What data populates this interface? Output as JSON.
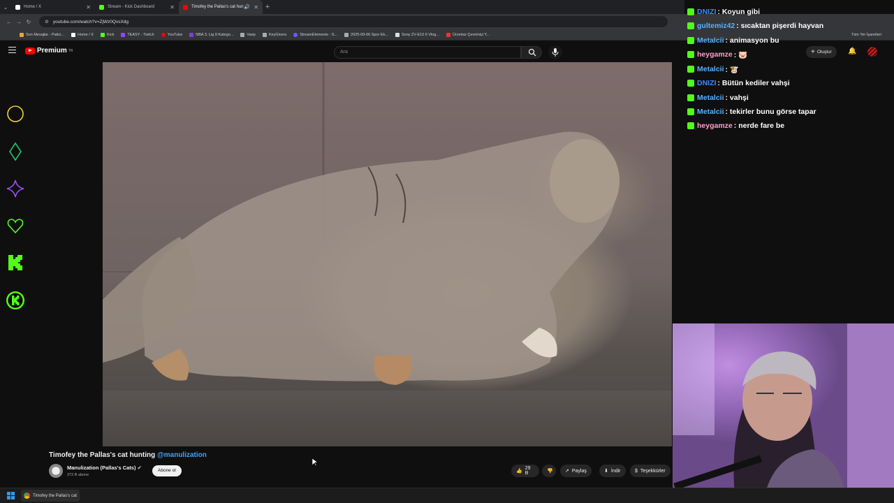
{
  "browser": {
    "tabs": [
      {
        "label": "Home / X",
        "active": false,
        "color": "#ffffff"
      },
      {
        "label": "Stream - Kick Dashboard",
        "active": false,
        "color": "#53fc18"
      },
      {
        "label": "Timofey the Pallas's cat hun",
        "active": true,
        "color": "#ff0000"
      }
    ],
    "url": "youtube.com/watch?v=ZjWz0QvsXdg",
    "bookmarks": [
      "Son Mesajlar - Patici...",
      "Home / X",
      "Kick",
      "TEASY - Twitch",
      "YouTube",
      "NBA 3. Lig 8 Katego...",
      "Vaep",
      "KeyGivers",
      "StreamElements - S...",
      "2025-09-06 Spor Ek...",
      "Sony ZV-E10 II Vlog...",
      "Ücretsiz Çevrimiçi Y..."
    ],
    "all_bookmarks": "Tüm Yer İşaretleri"
  },
  "youtube": {
    "logo": "Premium",
    "logo_region": "TR",
    "search_placeholder": "Ara",
    "create_label": "Oluştur",
    "video_title": "Timofey the Pallas's cat hunting",
    "video_title_mention": "@manulization",
    "channel_name": "Manulization (Pallas's Cats)",
    "subscribers": "372 B abone",
    "subscribe_label": "Abone ol",
    "likes": "29 B",
    "share_label": "Paylaş",
    "download_label": "İndir",
    "thanks_label": "Teşekkürler"
  },
  "chat": {
    "messages": [
      {
        "user": "DNIZI",
        "color": "#3b8bff",
        "text": ": Koyun gibi"
      },
      {
        "user": "gultemiz42",
        "color": "#5ab0ff",
        "text": ": sıcaktan pişerdi hayvan"
      },
      {
        "user": "Metalcii",
        "color": "#5ab0ff",
        "text": ": animasyon bu"
      },
      {
        "user": "heygamze",
        "color": "#ff9fd0",
        "text": ": 🐷"
      },
      {
        "user": "Metalcii",
        "color": "#5ab0ff",
        "text": ": 🐮"
      },
      {
        "user": "DNIZI",
        "color": "#3b8bff",
        "text": ": Bütün kediler vahşi"
      },
      {
        "user": "Metalcii",
        "color": "#5ab0ff",
        "text": ": vahşi"
      },
      {
        "user": "Metalcii",
        "color": "#5ab0ff",
        "text": ": tekirler bunu görse tapar"
      },
      {
        "user": "heygamze",
        "color": "#ff9fd0",
        "text": ": nerde fare be"
      }
    ]
  },
  "taskbar": {
    "active_window": "Timofey the Pallas's cat"
  },
  "colors": {
    "kick_green": "#53fc18",
    "youtube_red": "#ff0000",
    "link_blue": "#3ea6ff"
  }
}
